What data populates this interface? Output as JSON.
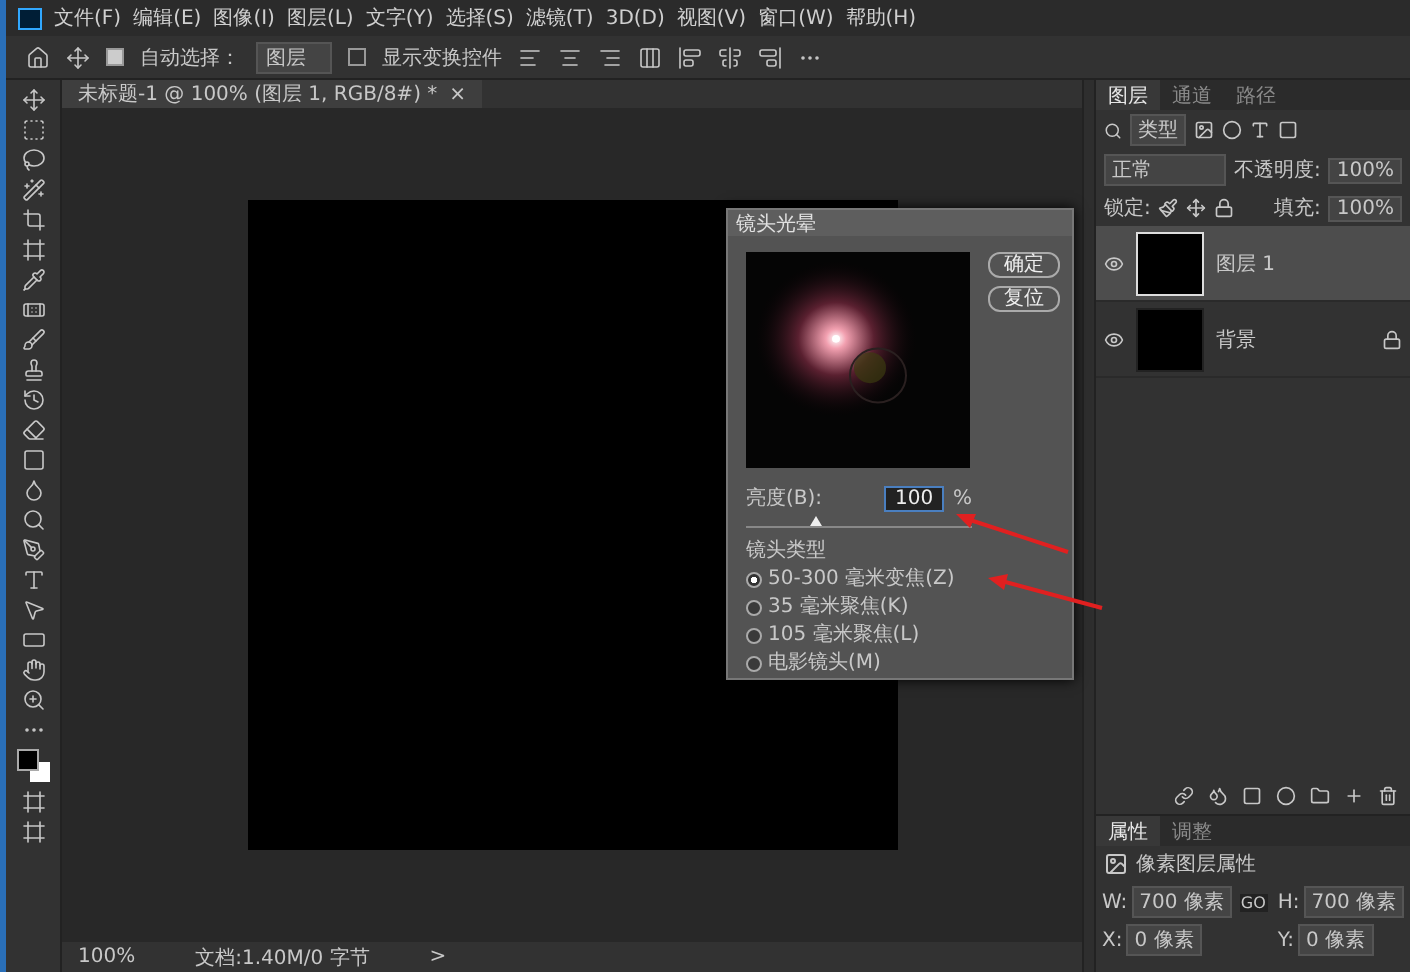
{
  "menu": [
    "文件(F)",
    "编辑(E)",
    "图像(I)",
    "图层(L)",
    "文字(Y)",
    "选择(S)",
    "滤镜(T)",
    "3D(D)",
    "视图(V)",
    "窗口(W)",
    "帮助(H)"
  ],
  "options": {
    "auto_select": {
      "label": "自动选择：",
      "checked": true
    },
    "target": "图层",
    "show_transform": {
      "label": "显示变换控件",
      "checked": false
    }
  },
  "document_tab": {
    "title": "未标题-1 @ 100% (图层 1, RGB/8#) *",
    "close": "×"
  },
  "dialog": {
    "title": "镜头光晕",
    "buttons": [
      "确定",
      "复位"
    ],
    "brightness": {
      "label": "亮度(B):",
      "value": "100",
      "unit": "%",
      "level": 0.31
    },
    "lens_type": {
      "label": "镜头类型",
      "options": [
        {
          "label": "50-300 毫米变焦(Z)",
          "selected": true
        },
        {
          "label": "35 毫米聚焦(K)",
          "selected": false
        },
        {
          "label": "105 毫米聚焦(L)",
          "selected": false
        },
        {
          "label": "电影镜头(M)",
          "selected": false
        }
      ]
    }
  },
  "layers_panel": {
    "tabs": [
      {
        "label": "图层",
        "selected": true
      },
      {
        "label": "通道",
        "selected": false
      },
      {
        "label": "路径",
        "selected": false
      }
    ],
    "filter": "类型",
    "blend_mode": "正常",
    "opacity": {
      "label": "不透明度:",
      "value": "100%"
    },
    "lock_label": "锁定:",
    "fill": {
      "label": "填充:",
      "value": "100%"
    },
    "layers": [
      {
        "name": "图层 1",
        "selected": true,
        "locked": false
      },
      {
        "name": "背景",
        "selected": false,
        "locked": true
      }
    ]
  },
  "properties_panel": {
    "tabs": [
      {
        "label": "属性",
        "selected": true
      },
      {
        "label": "调整",
        "selected": false
      }
    ],
    "title": "像素图层属性",
    "fields": [
      {
        "label": "W:",
        "value": "700 像素"
      },
      {
        "label": "H:",
        "value": "700 像素"
      },
      {
        "label": "X:",
        "value": "0 像素"
      },
      {
        "label": "Y:",
        "value": "0 像素"
      }
    ],
    "link": "GO"
  },
  "status_bar": {
    "zoom": "100%",
    "document": "文档:1.40M/0 字节",
    "arrow": ">"
  }
}
